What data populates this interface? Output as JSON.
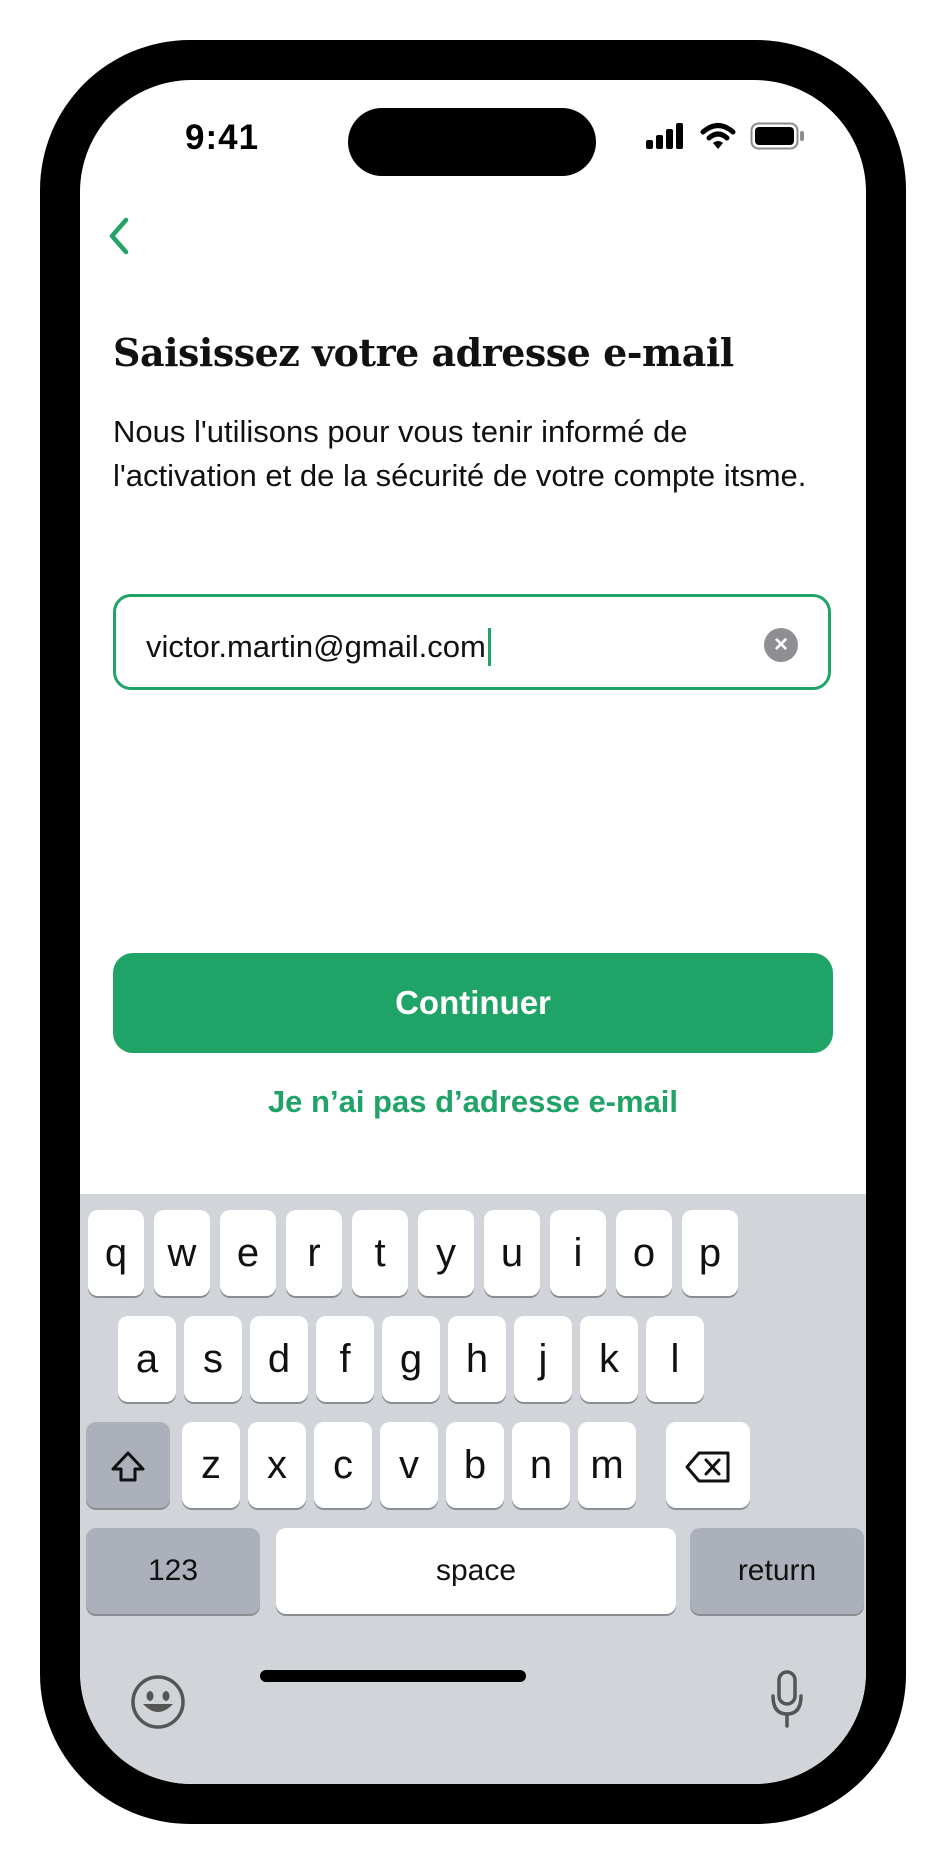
{
  "status_bar": {
    "time": "9:41"
  },
  "page": {
    "title": "Saisissez votre adresse e-mail",
    "description": "Nous l'utilisons pour vous tenir informé de l'activation et de la sécurité de votre compte itsme."
  },
  "email_field": {
    "value": "victor.martin@gmail.com",
    "clear_icon": "clear-icon"
  },
  "actions": {
    "continue_label": "Continuer",
    "no_email_label": "Je n’ai pas d’adresse e-mail"
  },
  "keyboard": {
    "row1": [
      "q",
      "w",
      "e",
      "r",
      "t",
      "y",
      "u",
      "i",
      "o",
      "p"
    ],
    "row2": [
      "a",
      "s",
      "d",
      "f",
      "g",
      "h",
      "j",
      "k",
      "l"
    ],
    "row3": [
      "z",
      "x",
      "c",
      "v",
      "b",
      "n",
      "m"
    ],
    "numbers_label": "123",
    "space_label": "space",
    "return_label": "return"
  },
  "colors": {
    "accent": "#1fa367",
    "keyboard_bg": "#d1d4d9",
    "func_key": "#abb0ba"
  }
}
